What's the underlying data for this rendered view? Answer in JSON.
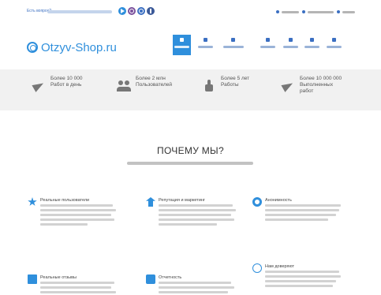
{
  "topbar": {
    "question_label": "Есть вопрос?",
    "question_text": "",
    "messengers": [
      {
        "icon": "telegram-icon",
        "color": "#2f8fdc"
      },
      {
        "icon": "viber-icon",
        "color": "#7b519d"
      },
      {
        "icon": "whatsapp-icon",
        "color": "#3b6fc2"
      },
      {
        "icon": "facebook-icon",
        "color": "#3b5998"
      }
    ],
    "links": [
      "",
      "",
      ""
    ]
  },
  "logo": {
    "text": "Otzyv-Shop.ru",
    "color": "#2f8fdc"
  },
  "nav": {
    "items": [
      {
        "label": "",
        "active": true
      },
      {
        "label": "",
        "active": false
      },
      {
        "label": "",
        "active": false
      },
      {
        "label": "",
        "active": false
      },
      {
        "label": "",
        "active": false
      },
      {
        "label": "",
        "active": false
      },
      {
        "label": "",
        "active": false
      }
    ],
    "active_color": "#2f8fdc"
  },
  "stats": [
    {
      "icon": "paper-plane-icon",
      "lines": [
        "Более 10 000",
        "Работ в день"
      ]
    },
    {
      "icon": "users-icon",
      "lines": [
        "Более 2 млн",
        "Пользователей"
      ]
    },
    {
      "icon": "thumbs-up-icon",
      "lines": [
        "Более 5 лет",
        "Работы"
      ]
    },
    {
      "icon": "paper-plane-icon",
      "lines": [
        "Более 10 000 000",
        "Выполненных",
        "работ"
      ]
    }
  ],
  "why": {
    "title": "ПОЧЕМУ МЫ?",
    "subtitle": ""
  },
  "features": [
    {
      "icon": "star-icon",
      "title": "Реальные пользователи",
      "text": ""
    },
    {
      "icon": "reputation-icon",
      "title": "Репутация и маркетинг",
      "text": ""
    },
    {
      "icon": "gear-icon",
      "title": "Анонимность",
      "text": ""
    },
    {
      "icon": "image-icon",
      "title": "Реальные отзывы",
      "text": ""
    },
    {
      "icon": "report-icon",
      "title": "Отчетность",
      "text": ""
    },
    {
      "icon": "smile-icon",
      "title": "Нам доверяют",
      "text": ""
    }
  ]
}
